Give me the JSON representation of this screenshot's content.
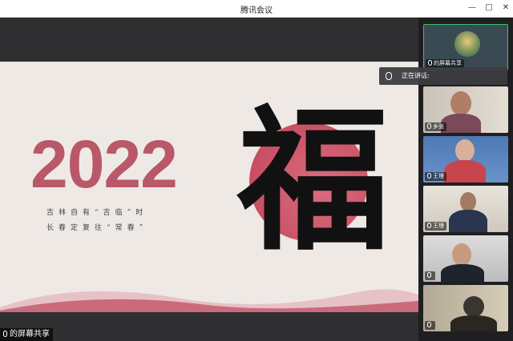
{
  "window": {
    "title": "腾讯会议",
    "minimize_glyph": "—",
    "maximize_glyph": "□",
    "close_glyph": "✕"
  },
  "slide": {
    "year": "2022",
    "line1": "吉林自有“吉临”时",
    "line2": "长春定复往“常春”",
    "calligraphy": "福"
  },
  "share_label": "的屏幕共享",
  "toast": {
    "text": "正在讲话: "
  },
  "participants": [
    {
      "name": "的屏幕共享",
      "active": true
    },
    {
      "name": "乡张",
      "active": false
    },
    {
      "name": "王理",
      "active": false
    },
    {
      "name": "王理",
      "active": false
    },
    {
      "name": "",
      "active": false
    },
    {
      "name": "",
      "active": false
    }
  ],
  "colors": {
    "accent": "#b95868",
    "active_border": "#3ebf6b"
  }
}
